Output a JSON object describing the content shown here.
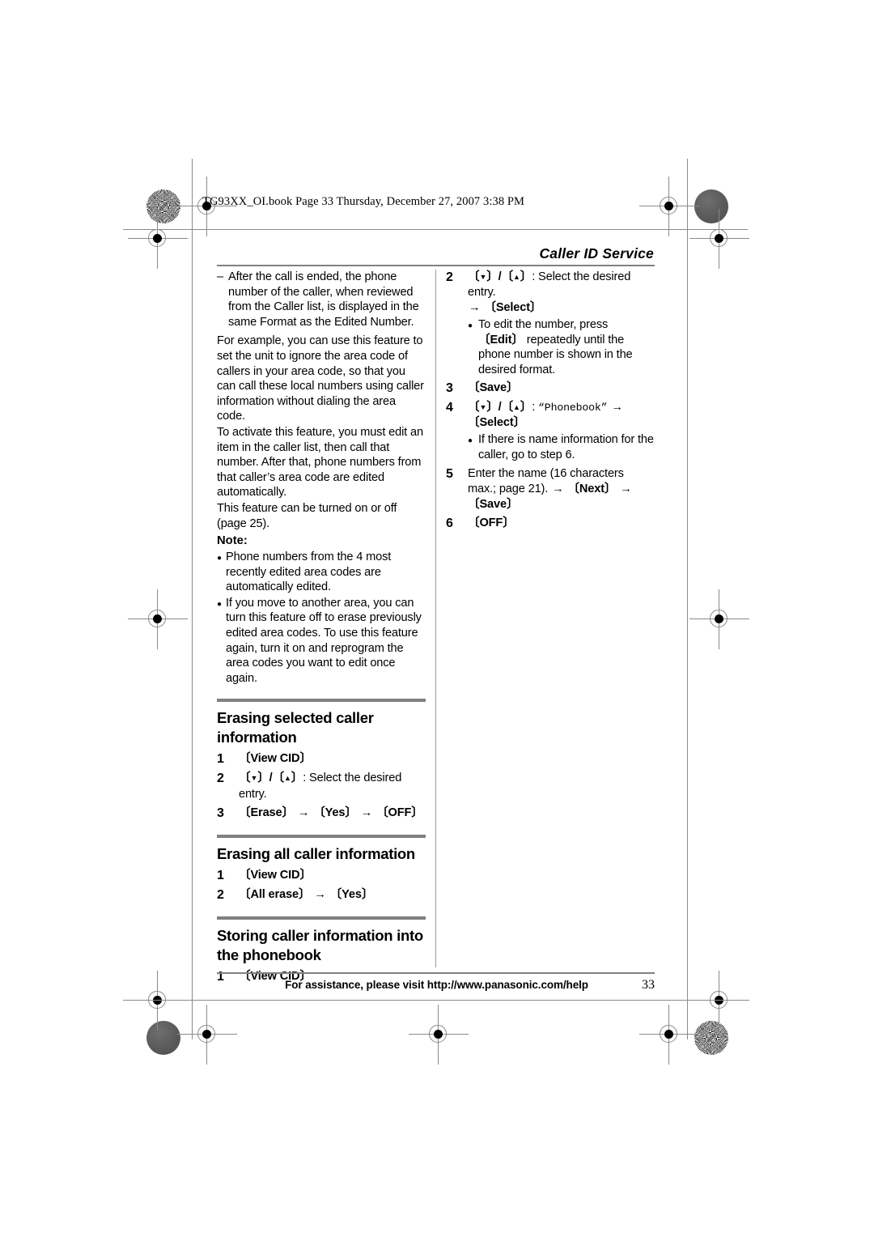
{
  "print_marks": {
    "filename_line": "TG93XX_OI.book  Page 33  Thursday, December 27, 2007  3:38 PM"
  },
  "header": {
    "running_head": "Caller ID Service"
  },
  "footer": {
    "assistance_text": "For assistance, please visit http://www.panasonic.com/help",
    "page_number": "33"
  },
  "left_column": {
    "dash_item": {
      "dash": "–",
      "text": "After the call is ended, the phone number of the caller, when reviewed from the Caller list, is displayed in the same Format as the Edited Number."
    },
    "paragraphs": [
      "For example, you can use this feature to set the unit to ignore the area code of callers in your area code, so that you can call these local numbers using caller information without dialing the area code.",
      "To activate this feature, you must edit an item in the caller list, then call that number. After that, phone numbers from that caller’s area code are edited automatically.",
      "This feature can be turned on or off (page 25)."
    ],
    "note_label": "Note:",
    "note_bullets": [
      "Phone numbers from the 4 most recently edited area codes are automatically edited.",
      "If you move to another area, you can turn this feature off to erase previously edited area codes. To use this feature again, turn it on and reprogram the area codes you want to edit once again."
    ],
    "sections": [
      {
        "title": "Erasing selected caller information",
        "steps": [
          {
            "num": "1",
            "parts": [
              {
                "type": "key",
                "text": "View CID"
              }
            ]
          },
          {
            "num": "2",
            "parts": [
              {
                "type": "nav",
                "text": "down/up"
              },
              {
                "type": "plain",
                "text": ": Select the desired entry."
              }
            ]
          },
          {
            "num": "3",
            "parts": [
              {
                "type": "key",
                "text": "Erase"
              },
              {
                "type": "arrow",
                "text": "→"
              },
              {
                "type": "key",
                "text": "Yes"
              },
              {
                "type": "arrow",
                "text": "→"
              },
              {
                "type": "key",
                "text": "OFF"
              }
            ]
          }
        ]
      },
      {
        "title": "Erasing all caller information",
        "steps": [
          {
            "num": "1",
            "parts": [
              {
                "type": "key",
                "text": "View CID"
              }
            ]
          },
          {
            "num": "2",
            "parts": [
              {
                "type": "key",
                "text": "All erase"
              },
              {
                "type": "arrow",
                "text": "→"
              },
              {
                "type": "key",
                "text": "Yes"
              }
            ]
          }
        ]
      },
      {
        "title": "Storing caller information into the phonebook",
        "steps": [
          {
            "num": "1",
            "parts": [
              {
                "type": "key",
                "text": "View CID"
              }
            ]
          }
        ]
      }
    ]
  },
  "right_column": {
    "steps": [
      {
        "num": "2",
        "line1_nav": "down/up",
        "line1_text": ": Select the desired entry.",
        "line2_arrow": "→",
        "line2_key": "Select",
        "substeps": [
          {
            "pre": "To edit the number, press ",
            "key": "Edit",
            "post": " repeatedly until the phone number is shown in the desired format."
          }
        ]
      },
      {
        "num": "3",
        "key_only": "Save"
      },
      {
        "num": "4",
        "line1_nav": "down/up",
        "line1_text": ": ",
        "line1_mono": "“Phonebook”",
        "line1_arrow": "→",
        "line2_key": "Select",
        "substeps": [
          {
            "pre": "If there is name information for the caller, go to step 6.",
            "key": "",
            "post": ""
          }
        ]
      },
      {
        "num": "5",
        "text_pre": "Enter the name (16 characters max.; page 21). ",
        "arrow1": "→",
        "key1": "Next",
        "arrow2": "→",
        "key2": "Save"
      },
      {
        "num": "6",
        "key_only": "OFF"
      }
    ]
  },
  "colors": {
    "rule": "#808080",
    "divider": "#9a9a9a",
    "text": "#000000"
  }
}
